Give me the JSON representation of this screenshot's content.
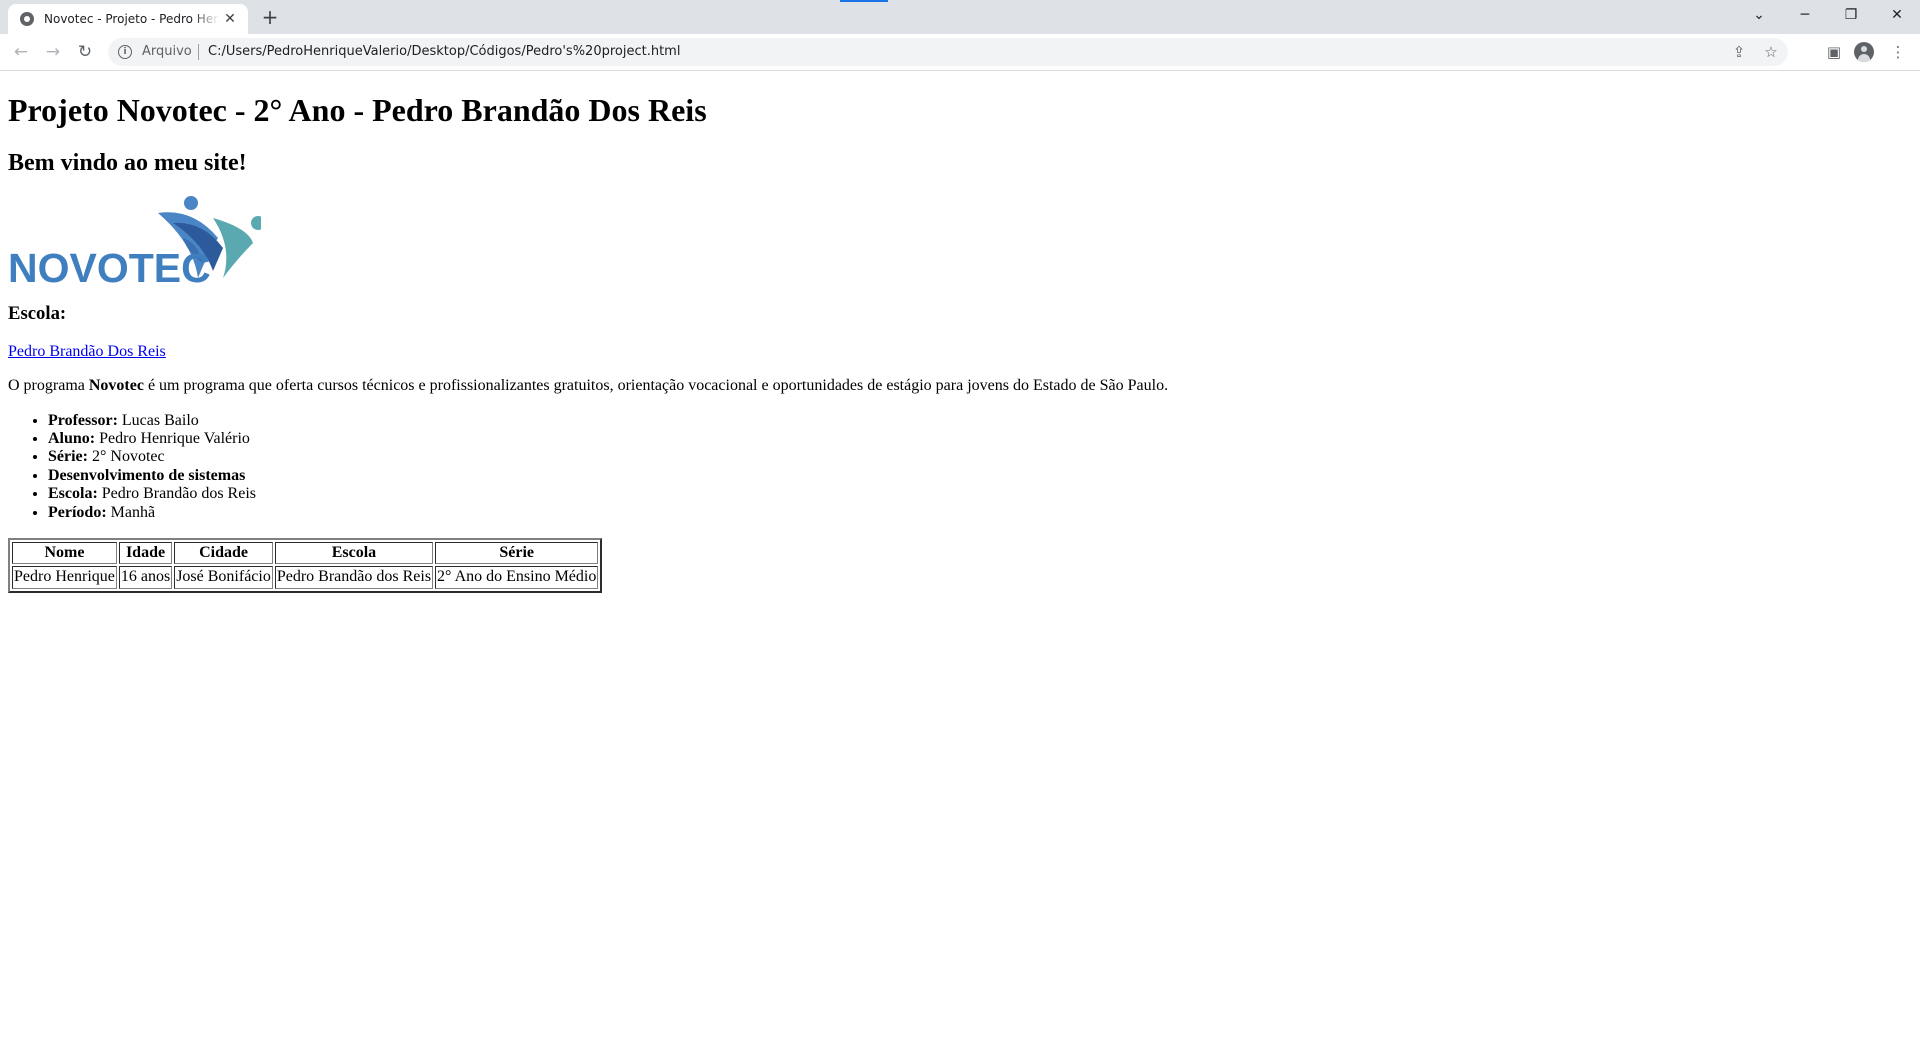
{
  "browser": {
    "tab_title": "Novotec - Projeto - Pedro Henrique",
    "tab_close": "✕",
    "new_tab": "+",
    "omnibox_label": "Arquivo",
    "url": "C:/Users/PedroHenriqueValerio/Desktop/Códigos/Pedro's%20project.html",
    "window_controls": {
      "minimize": "─",
      "restore": "❐",
      "close": "✕",
      "tab_search": "⌄"
    },
    "nav": {
      "back": "←",
      "forward": "→",
      "reload": "↻"
    }
  },
  "page": {
    "title": "Projeto Novotec - 2° Ano - Pedro Brandão Dos Reis",
    "subtitle": "Bem vindo ao meu site!",
    "logo_text": "NOVOTEC",
    "escola_heading": "Escola:",
    "school_link": "Pedro Brandão Dos Reis",
    "paragraph": {
      "before": "O programa ",
      "bold": "Novotec",
      "after": " é um programa que oferta cursos técnicos e profissionalizantes gratuitos, orientação vocacional e oportunidades de estágio para jovens do Estado de São Paulo."
    },
    "info_list": [
      {
        "label": "Professor:",
        "value": " Lucas Bailo"
      },
      {
        "label": "Aluno:",
        "value": " Pedro Henrique Valério"
      },
      {
        "label": "Série:",
        "value": " 2° Novotec"
      },
      {
        "label": "Desenvolvimento de sistemas",
        "value": ""
      },
      {
        "label": "Escola:",
        "value": " Pedro Brandão dos Reis"
      },
      {
        "label": "Período:",
        "value": " Manhã"
      }
    ],
    "table": {
      "headers": [
        "Nome",
        "Idade",
        "Cidade",
        "Escola",
        "Série"
      ],
      "rows": [
        [
          "Pedro Henrique",
          "16 anos",
          "José Bonifácio",
          "Pedro Brandão dos Reis",
          "2° Ano do Ensino Médio"
        ]
      ]
    }
  },
  "colors": {
    "logo_text": "#3f7fbf",
    "logo_dark_blue": "#2d5a9a",
    "logo_mid_blue": "#4a86c6",
    "logo_teal": "#5aa9b0",
    "link": "#0000ee"
  }
}
